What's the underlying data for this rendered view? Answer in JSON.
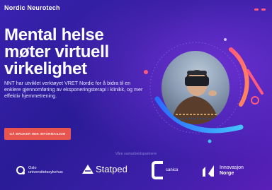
{
  "header": {
    "brand": "Nordic Neurotech"
  },
  "hero": {
    "title_lines": [
      "Mental helse",
      "møter virtuell",
      "virkelighet"
    ],
    "description": "NNT har utviklet verktøyet VRET Nordic for å bidra til en enklere gjennomføring av eksponeringsterapi i klinikk, og mer effektiv hjemmetrening.",
    "cta_label": "GÅ BRUKER HER INFORMASJON"
  },
  "partners": {
    "label": "Våre samarbeidspartnere",
    "items": [
      {
        "name_lines": [
          "Oslo",
          "universitetssykehus"
        ],
        "icon": "oslo-universitetssykehus-logo-icon"
      },
      {
        "name_lines": [
          "Statped"
        ],
        "icon": "statped-logo-icon"
      },
      {
        "name_lines": [
          "canica"
        ],
        "icon": "canica-logo-icon"
      },
      {
        "name_lines": [
          "Innovasjon",
          "Norge"
        ],
        "icon": "innovasjon-norge-logo-icon"
      }
    ]
  },
  "colors": {
    "background": "#2a1a8c",
    "accent_coral": "#e8554f",
    "accent_pink": "#ff5a7a",
    "accent_blue": "#3aa0ff"
  }
}
